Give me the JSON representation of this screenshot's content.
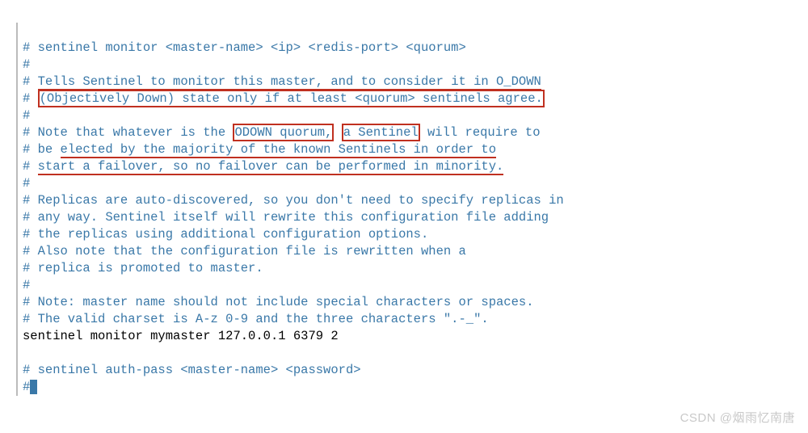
{
  "lines": {
    "l1": "# sentinel monitor <master-name> <ip> <redis-port> <quorum>",
    "l2": "#",
    "l3a": "# ",
    "l3b": "Tells Sentinel to monitor this master, and to consider it in O_DOWN",
    "l4a": "# ",
    "l4b": "(Objectively Down) state only if at least <quorum> sentinels agree.",
    "l5": "#",
    "l6a": "# Note that whatever is the ",
    "l6b": "ODOWN quorum,",
    "l6c": " ",
    "l6d": "a Sentinel",
    "l6e": " will require to",
    "l7a": "# be ",
    "l7b": "elected by the majority of the known Sentinels in order to",
    "l8a": "# ",
    "l8b": "start a failover, so no failover can be performed in minority.",
    "l9": "#",
    "l10": "# Replicas are auto-discovered, so you don't need to specify replicas in",
    "l11": "# any way. Sentinel itself will rewrite this configuration file adding",
    "l12": "# the replicas using additional configuration options.",
    "l13": "# Also note that the configuration file is rewritten when a",
    "l14": "# replica is promoted to master.",
    "l15": "#",
    "l16": "# Note: master name should not include special characters or spaces.",
    "l17": "# The valid charset is A-z 0-9 and the three characters \".-_\".",
    "l18": "sentinel monitor mymaster 127.0.0.1 6379 2",
    "l19": "",
    "l20": "# sentinel auth-pass <master-name> <password>",
    "l21": "#"
  },
  "watermark": "CSDN @烟雨忆南唐"
}
